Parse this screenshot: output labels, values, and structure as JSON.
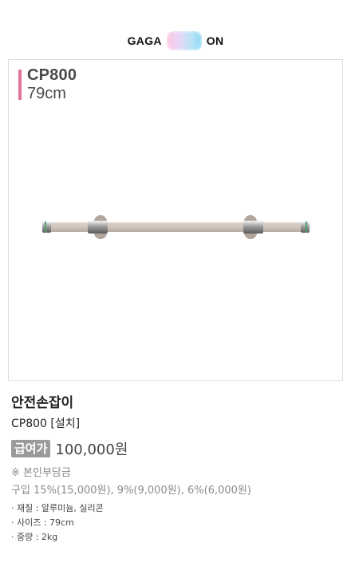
{
  "brand": {
    "left": "GAGA",
    "right": "ON"
  },
  "product_image": {
    "model": "CP800",
    "size": "79cm",
    "accent_color": "#e0729a"
  },
  "product": {
    "name": "안전손잡이",
    "variant": "CP800 [설치]",
    "badge": "급여가",
    "price": "100,000원",
    "note": "※ 본인부담금",
    "copay_rates": "구입 15%(15,000원), 9%(9,000원), 6%(6,000원)"
  },
  "specs": [
    "· 재질 : 알루미늄, 실리콘",
    "· 사이즈 : 79cm",
    "· 중량 : 2kg"
  ]
}
